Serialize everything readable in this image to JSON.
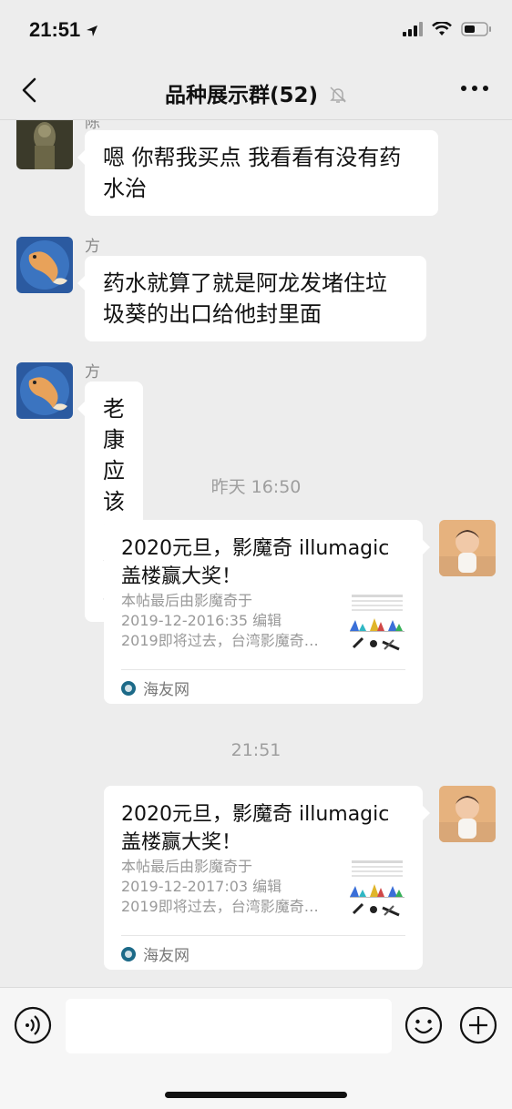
{
  "status": {
    "time": "21:51"
  },
  "nav": {
    "title": "品种展示群(52)"
  },
  "messages": [
    {
      "sender": "陈杰",
      "text_lines": [
        "嗯 你帮我买点 我看看有没有药",
        "水治"
      ]
    },
    {
      "sender": "方🎮",
      "text_lines": [
        "药水就算了就是阿龙发堵住垃",
        "圾葵的出口给他封里面"
      ]
    },
    {
      "sender": "方🎮",
      "text_lines": [
        "老康应该有经验"
      ]
    }
  ],
  "timestamps": [
    "昨天 16:50",
    "21:51"
  ],
  "cards": [
    {
      "title_lines": [
        "2020元旦，影魔奇 illumagic",
        "盖楼赢大奖！"
      ],
      "desc_lines": [
        "本帖最后由影魔奇于",
        "2019-12-2016:35 编辑",
        "2019即将过去，台湾影魔奇…"
      ],
      "source": "海友网"
    },
    {
      "title_lines": [
        "2020元旦，影魔奇 illumagic",
        "盖楼赢大奖！"
      ],
      "desc_lines": [
        "本帖最后由影魔奇于",
        "2019-12-2017:03 编辑",
        "2019即将过去，台湾影魔奇…"
      ],
      "source": "海友网"
    }
  ],
  "colors": {
    "background": "#ededed",
    "bubble": "#ffffff",
    "accent": "#1c6a88"
  }
}
